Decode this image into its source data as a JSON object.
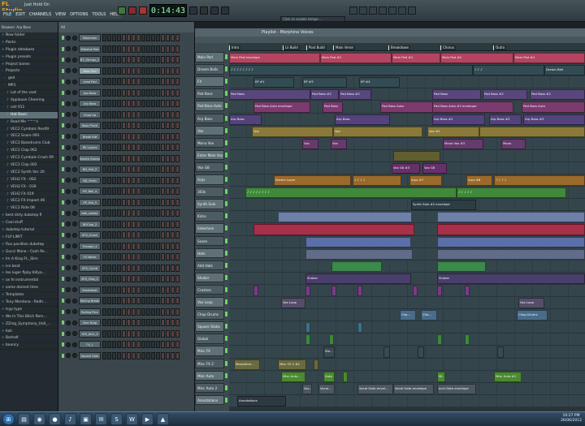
{
  "app": {
    "logo": "FL Studio",
    "project": "Just Hold On"
  },
  "menu": [
    "FILE",
    "EDIT",
    "CHANNELS",
    "VIEW",
    "OPTIONS",
    "TOOLS",
    "HELP"
  ],
  "transport": {
    "time": "0:14:43",
    "hint": "Click to enable tempo ..."
  },
  "channel_box": "Arp Bass",
  "browser": {
    "header": "Browser",
    "items": [
      {
        "icon": "+",
        "label": "New folder"
      },
      {
        "icon": "+",
        "label": "Packs"
      },
      {
        "icon": "+",
        "label": "Plugin database"
      },
      {
        "icon": "+",
        "label": "Plugin presets"
      },
      {
        "icon": "+",
        "label": "Project bones"
      },
      {
        "icon": "-",
        "label": "Projects"
      },
      {
        "icon": "-",
        "label": "ged"
      },
      {
        "icon": "-",
        "label": "MP3"
      },
      {
        "icon": "♪",
        "label": "Lot of the vast"
      },
      {
        "icon": "♪",
        "label": "Applause Cheering"
      },
      {
        "icon": "♪",
        "label": "cell 911"
      },
      {
        "icon": "♪",
        "label": "Hat Basic"
      },
      {
        "icon": "♪",
        "label": "Read Me ^^^n"
      },
      {
        "icon": "♪",
        "label": "VEC2 Cymbals Rev09"
      },
      {
        "icon": "♪",
        "label": "VEC2 Snare 093"
      },
      {
        "icon": "♪",
        "label": "VEC2 Bassdrums Club"
      },
      {
        "icon": "♪",
        "label": "VEC2 Clap 062"
      },
      {
        "icon": "♪",
        "label": "VEC2 Cymbals Crash 09"
      },
      {
        "icon": "♪",
        "label": "VEC2 Clap 002"
      },
      {
        "icon": "♪",
        "label": "VEC2 Synth Voc 26"
      },
      {
        "icon": "♪",
        "label": "VEH2 FX - 062"
      },
      {
        "icon": "♪",
        "label": "VEH2 FX - 039"
      },
      {
        "icon": "♪",
        "label": "VEH2 FX 019"
      },
      {
        "icon": "♪",
        "label": "VEC2 FX Impact 46"
      },
      {
        "icon": "♪",
        "label": "VEC2 Ride 08"
      },
      {
        "icon": "+",
        "label": "best dirty dubstep fl"
      },
      {
        "icon": "+",
        "label": "Cool stuff"
      },
      {
        "icon": "+",
        "label": "dubstep tutorial"
      },
      {
        "icon": "+",
        "label": "FLP LIMIT"
      },
      {
        "icon": "+",
        "label": "flux pavillion dubstep"
      },
      {
        "icon": "+",
        "label": "Gucci Mane - Cash Re..."
      },
      {
        "icon": "+",
        "label": "Im A King Ft._Slim"
      },
      {
        "icon": "+",
        "label": "ice beat"
      },
      {
        "icon": "+",
        "label": "lex luger flpby Killya..."
      },
      {
        "icon": "+",
        "label": "ox fe instrumental"
      },
      {
        "icon": "+",
        "label": "same damed time"
      },
      {
        "icon": "+",
        "label": "Templates"
      },
      {
        "icon": "+",
        "label": "Tony Montana - Redh..."
      },
      {
        "icon": "+",
        "label": "tryp type"
      },
      {
        "icon": "+",
        "label": "We In This Bitch Rem..."
      },
      {
        "icon": "+",
        "label": "ZZmg_Symphony_Hall_..."
      },
      {
        "icon": "+",
        "label": "Ilah"
      },
      {
        "icon": "+",
        "label": "Barhalf"
      },
      {
        "icon": "+",
        "label": "bouncy"
      }
    ]
  },
  "rack": {
    "header": "All",
    "channels": [
      "Sidechain",
      "Massive Pad",
      "BT_Strings_2",
      "Bass Pad",
      "Lead Pad",
      "Arp Bass",
      "Arp Bass",
      "Chop Up",
      "Bass Pluck",
      "Break Rdf",
      "Fill Layers",
      "Sweep Sweep",
      "BD_Hat_2",
      "BD_Fresh",
      "HP_Bell_4",
      "HP_Hat_5",
      "bdk_sweep",
      "BDClap_2",
      "SFX_Crash",
      "Triangle_4",
      "FX Noise",
      "SFX_Cymb",
      "SFX_Clap_2",
      "Breakbeat",
      "Rolling Break",
      "Rolling Perc",
      "Sine Drop",
      "SFX_Kick_3",
      "FX_1",
      "Square Stab"
    ]
  },
  "playlist": {
    "title": "Playlist - Morphine Voices",
    "markers": [
      "Intro",
      "Lil Build",
      "Post Build",
      "Main Verse",
      "Breakdown",
      "Chorus",
      "Outro"
    ],
    "tracks": [
      {
        "name": "Main Pad",
        "clips": [
          {
            "start": 0,
            "len": 112,
            "label": "Main Pad envelope"
          },
          {
            "start": 112,
            "len": 88,
            "label": "Main Pad #3"
          },
          {
            "start": 200,
            "len": 60,
            "label": "Main Pad #4"
          },
          {
            "start": 260,
            "len": 90,
            "label": "Main Pad #4"
          },
          {
            "start": 350,
            "len": 88,
            "label": "Main Pad #4"
          }
        ],
        "color": "#b2455f"
      },
      {
        "name": "Dream Bells",
        "clips": [
          {
            "start": 0,
            "len": 300,
            "label": "♪ ♪ ♪ ♪ ♪ ♪ ♪ ♪"
          },
          {
            "start": 300,
            "len": 88,
            "label": "♪ ♪ ♪"
          },
          {
            "start": 388,
            "len": 50,
            "label": "Dream Bell"
          }
        ],
        "color": "#334c54"
      },
      {
        "name": "FX",
        "clips": [
          {
            "start": 30,
            "len": 50,
            "label": "EP #1"
          },
          {
            "start": 90,
            "len": 55,
            "label": "EP #3"
          },
          {
            "start": 160,
            "len": 50,
            "label": "EP #4"
          }
        ],
        "color": "#334c54"
      },
      {
        "name": "Pad Bass",
        "clips": [
          {
            "start": 0,
            "len": 100,
            "label": "Pad Bass"
          },
          {
            "start": 100,
            "len": 35,
            "label": "Pad Bass #2"
          },
          {
            "start": 135,
            "len": 40,
            "label": "Pad Bass #2"
          },
          {
            "start": 250,
            "len": 60,
            "label": "Pad Bass"
          },
          {
            "start": 312,
            "len": 55,
            "label": "Pad Bass #2"
          },
          {
            "start": 370,
            "len": 68,
            "label": "Pad Bass #2"
          }
        ],
        "color": "#58467c"
      },
      {
        "name": "Pad Bass Auto",
        "clips": [
          {
            "start": 30,
            "len": 70,
            "label": "Pad Bass Auto envelope"
          },
          {
            "start": 115,
            "len": 25,
            "label": "Pad Bass"
          },
          {
            "start": 186,
            "len": 70,
            "label": "Pad Bass Auto"
          },
          {
            "start": 250,
            "len": 100,
            "label": "Pad Bass Auto #2 envelope"
          },
          {
            "start": 360,
            "len": 78,
            "label": "Pad Bass Auto"
          }
        ],
        "color": "#7c3a6e"
      },
      {
        "name": "Arp Bass",
        "clips": [
          {
            "start": 0,
            "len": 40,
            "label": "Arp Bass"
          },
          {
            "start": 130,
            "len": 68,
            "label": "Arp Bass"
          },
          {
            "start": 250,
            "len": 65,
            "label": "Arp Bass #2"
          },
          {
            "start": 320,
            "len": 40,
            "label": "Arp Bass #3"
          },
          {
            "start": 362,
            "len": 76,
            "label": "Arp Bass #3"
          }
        ],
        "color": "#54427a"
      },
      {
        "name": "Vox",
        "clips": [
          {
            "start": 28,
            "len": 100,
            "label": "Vox"
          },
          {
            "start": 128,
            "len": 110,
            "label": "Vox"
          },
          {
            "start": 244,
            "len": 64,
            "label": "Vox #2"
          },
          {
            "start": 308,
            "len": 130,
            "label": ""
          }
        ],
        "color": "#8a7a3a"
      },
      {
        "name": "Mono Vox",
        "clips": [
          {
            "start": 90,
            "len": 20,
            "label": "Vox"
          },
          {
            "start": 125,
            "len": 20,
            "label": "Vox"
          },
          {
            "start": 263,
            "len": 50,
            "label": "Mono Vox #3"
          },
          {
            "start": 335,
            "len": 30,
            "label": "Mono"
          }
        ],
        "color": "#663a6c"
      },
      {
        "name": "Enter Main Vox",
        "clips": [
          {
            "start": 202,
            "len": 58,
            "label": ""
          }
        ],
        "color": "#5f5f30"
      },
      {
        "name": "Vox G8",
        "clips": [
          {
            "start": 200,
            "len": 35,
            "label": "Vox G8 #3"
          },
          {
            "start": 238,
            "len": 30,
            "label": "Vox G8"
          }
        ],
        "color": "#66306a"
      },
      {
        "name": "Arps",
        "clips": [
          {
            "start": 55,
            "len": 95,
            "label": "Dream Layer"
          },
          {
            "start": 152,
            "len": 60,
            "label": "♪ ♪ ♪ ♪"
          },
          {
            "start": 222,
            "len": 40,
            "label": "Arps #7"
          },
          {
            "start": 292,
            "len": 32,
            "label": "Arps #8"
          },
          {
            "start": 326,
            "len": 112,
            "label": "♪ ♪ ♪ ♪"
          }
        ],
        "color": "#9a6a2c"
      },
      {
        "name": "303s",
        "clips": [
          {
            "start": 20,
            "len": 260,
            "label": "♪ ♪ ♪ ♪ ♪ ♪ ♪ ♪"
          },
          {
            "start": 280,
            "len": 135,
            "label": "♪ ♪ ♪ ♪ ♪"
          }
        ],
        "color": "#3e8a3a"
      },
      {
        "name": "Synth Solo",
        "clips": [
          {
            "start": 224,
            "len": 80,
            "label": "Synth Solo #2 envelope"
          }
        ],
        "color": "#2c3e44"
      },
      {
        "name": "Kicks",
        "clips": [
          {
            "start": 60,
            "len": 165,
            "label": ""
          },
          {
            "start": 256,
            "len": 182,
            "label": ""
          }
        ],
        "color": "#6e7fa8"
      },
      {
        "name": "Sidechain",
        "clips": [
          {
            "start": 30,
            "len": 198,
            "label": ""
          },
          {
            "start": 256,
            "len": 182,
            "label": ""
          }
        ],
        "color": "#a8304a"
      },
      {
        "name": "Snare",
        "clips": [
          {
            "start": 94,
            "len": 130,
            "label": ""
          },
          {
            "start": 256,
            "len": 182,
            "label": ""
          }
        ],
        "color": "#5a6ea8"
      },
      {
        "name": "Hats",
        "clips": [
          {
            "start": 94,
            "len": 132,
            "label": ""
          },
          {
            "start": 256,
            "len": 182,
            "label": ""
          }
        ],
        "color": "#606c8a"
      },
      {
        "name": "Add Hats",
        "clips": [
          {
            "start": 126,
            "len": 62,
            "label": ""
          },
          {
            "start": 256,
            "len": 60,
            "label": ""
          }
        ],
        "color": "#3a8a4a"
      },
      {
        "name": "Shaker",
        "clips": [
          {
            "start": 94,
            "len": 130,
            "label": "Shaker"
          },
          {
            "start": 256,
            "len": 182,
            "label": "Shaker"
          }
        ],
        "color": "#4a3e6a"
      },
      {
        "name": "Crashes",
        "clips": [
          {
            "start": 30,
            "len": 6,
            "label": ""
          },
          {
            "start": 94,
            "len": 6,
            "label": ""
          },
          {
            "start": 126,
            "len": 6,
            "label": ""
          },
          {
            "start": 158,
            "len": 6,
            "label": ""
          },
          {
            "start": 226,
            "len": 6,
            "label": ""
          },
          {
            "start": 256,
            "len": 6,
            "label": ""
          },
          {
            "start": 290,
            "len": 6,
            "label": ""
          }
        ],
        "color": "#7a3a8a"
      },
      {
        "name": "Vox Loop",
        "clips": [
          {
            "start": 64,
            "len": 30,
            "label": "Vox Loop"
          },
          {
            "start": 356,
            "len": 32,
            "label": "Vox Loop"
          }
        ],
        "color": "#544e68"
      },
      {
        "name": "Chop Drums",
        "clips": [
          {
            "start": 210,
            "len": 20,
            "label": "Cho..."
          },
          {
            "start": 236,
            "len": 20,
            "label": "Cho..."
          },
          {
            "start": 354,
            "len": 38,
            "label": "Chop Drums"
          }
        ],
        "color": "#4a6c8a"
      },
      {
        "name": "Square Stabs",
        "clips": [
          {
            "start": 94,
            "len": 6,
            "label": ""
          },
          {
            "start": 158,
            "len": 6,
            "label": ""
          }
        ],
        "color": "#3e7088"
      },
      {
        "name": "Global",
        "clips": [
          {
            "start": 94,
            "len": 6,
            "label": ""
          },
          {
            "start": 123,
            "len": 6,
            "label": ""
          },
          {
            "start": 256,
            "len": 6,
            "label": ""
          },
          {
            "start": 290,
            "len": 6,
            "label": ""
          }
        ],
        "color": "#3a8a40"
      },
      {
        "name": "Misc FX",
        "clips": [
          {
            "start": 116,
            "len": 14,
            "label": "Ste..."
          },
          {
            "start": 190,
            "len": 8,
            "label": ""
          },
          {
            "start": 232,
            "len": 8,
            "label": ""
          },
          {
            "start": 330,
            "len": 8,
            "label": ""
          }
        ],
        "color": "#3a4a50"
      },
      {
        "name": "Misc FX 2",
        "clips": [
          {
            "start": 6,
            "len": 32,
            "label": "Morphinel..."
          },
          {
            "start": 60,
            "len": 35,
            "label": "Misc FX 2 #2"
          },
          {
            "start": 104,
            "len": 6,
            "label": ""
          }
        ],
        "color": "#6a6a40"
      },
      {
        "name": "Misc Auto",
        "clips": [
          {
            "start": 64,
            "len": 30,
            "label": "Misc Auto..."
          },
          {
            "start": 116,
            "len": 14,
            "label": "Auto"
          },
          {
            "start": 140,
            "len": 6,
            "label": ""
          },
          {
            "start": 256,
            "len": 10,
            "label": "Mi..."
          },
          {
            "start": 326,
            "len": 34,
            "label": "Misc Auto #2"
          }
        ],
        "color": "#4a8a30"
      },
      {
        "name": "Misc Auto 2",
        "clips": [
          {
            "start": 90,
            "len": 12,
            "label": "Voc..."
          },
          {
            "start": 110,
            "len": 20,
            "label": "Vocal..."
          },
          {
            "start": 158,
            "len": 44,
            "label": "Vocal Gate envel..."
          },
          {
            "start": 202,
            "len": 50,
            "label": "Vocal Gate envelope"
          },
          {
            "start": 256,
            "len": 48,
            "label": "ocal Gate envelope"
          }
        ],
        "color": "#4c5860"
      },
      {
        "name": "Annotations",
        "clips": [
          {
            "start": 10,
            "len": 60,
            "label": "Annotations"
          }
        ],
        "color": "#2c3a40"
      }
    ]
  },
  "taskbar": {
    "time": "10:27 PM",
    "date": "26/06/2012"
  }
}
